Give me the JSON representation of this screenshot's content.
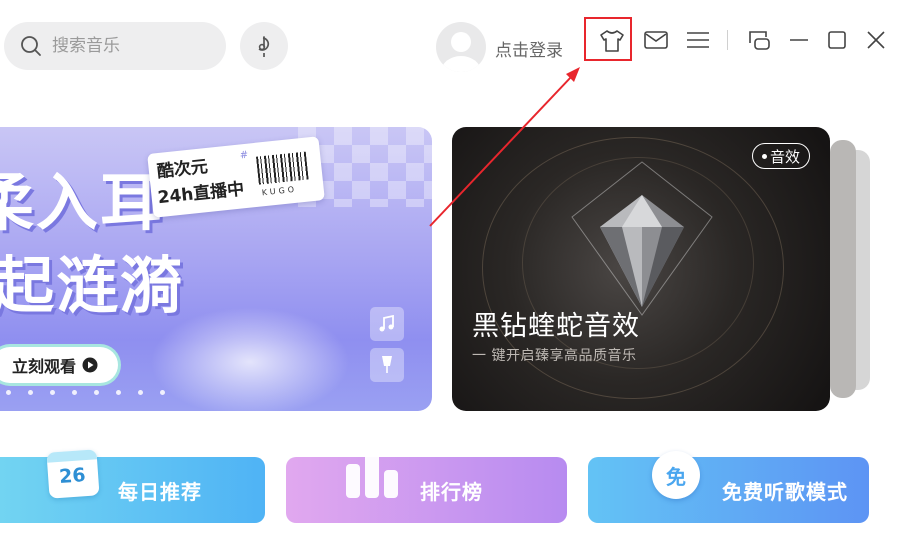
{
  "header": {
    "search_placeholder": "搜索音乐",
    "login_text": "点击登录",
    "icons": [
      "search-icon",
      "voice-search-icon",
      "avatar",
      "skin-icon",
      "mail-icon",
      "menu-icon",
      "mini-mode-icon",
      "minimize-icon",
      "maximize-icon",
      "close-icon"
    ]
  },
  "annotation": {
    "highlight_color": "#e8262d"
  },
  "banner_left": {
    "headline_1": "柔入耳",
    "headline_2": "起涟漪",
    "ticket_line1": "酷次元",
    "ticket_line2": "24h直播中",
    "ticket_brand": "KUGO",
    "ticket_hash": "#",
    "watch_button": "立刻观看",
    "dot_count": 8
  },
  "banner_right": {
    "badge": "音效",
    "title": "黑钻蝰蛇音效",
    "subtitle": "一 键开启臻享高品质音乐"
  },
  "tiles": [
    {
      "icon_text": "26",
      "label": "每日推荐",
      "color_start": "#72d4f2",
      "color_end": "#4fb3f5"
    },
    {
      "label": "排行榜",
      "color_start": "#e1a8ef",
      "color_end": "#b78bf0"
    },
    {
      "icon_text": "免",
      "label": "免费听歌模式",
      "color_start": "#63c3f5",
      "color_end": "#5d94f4"
    }
  ]
}
